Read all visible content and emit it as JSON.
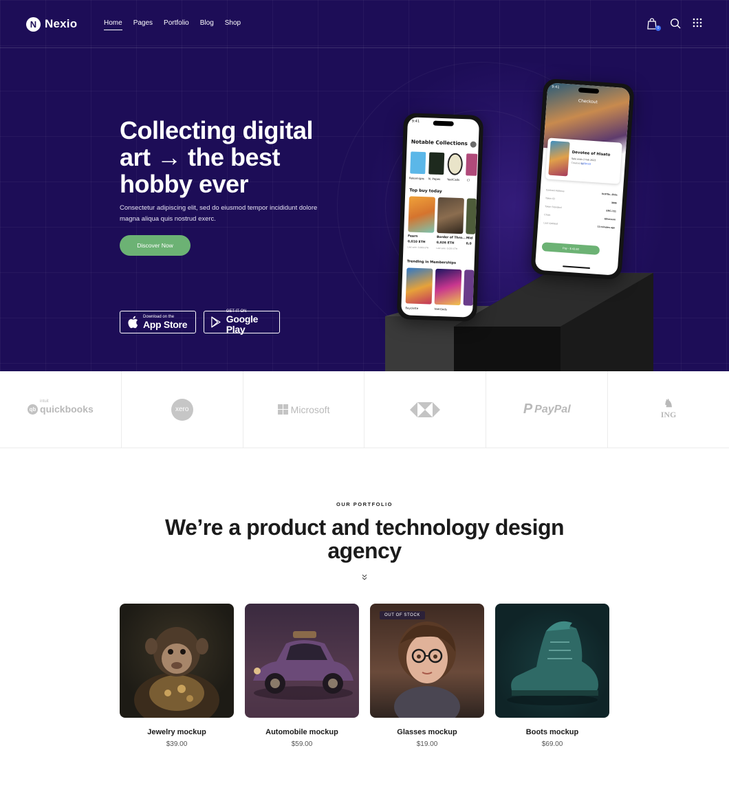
{
  "header": {
    "logo_mark": "N",
    "logo_text": "Nexio",
    "nav": [
      "Home",
      "Pages",
      "Portfolio",
      "Blog",
      "Shop"
    ],
    "active_nav": "Home",
    "cart_count": "0",
    "icons": [
      "shopping-bag-icon",
      "search-icon",
      "grid-menu-icon"
    ]
  },
  "hero": {
    "title": "Collecting digital art → the best hobby ever",
    "subtitle": "Consectetur adipiscing elit, sed do eiusmod tempor incididunt dolore magna aliqua quis nostrud exerc.",
    "cta": "Discover Now",
    "app_store": {
      "small": "Download on the",
      "big": "App Store"
    },
    "google_play": {
      "small": "GET IT ON",
      "big": "Google Play"
    }
  },
  "phone_left": {
    "time": "9:41",
    "heading": "Notable Collections",
    "collections": [
      "Rekamigas",
      "N. Pepes",
      "YeetCads",
      "Cl"
    ],
    "top_buy_label": "Top buy today",
    "top_buys": [
      {
        "name": "Fearn",
        "price": "0,010 ETH",
        "sub": "Last sale: 0,009 ETH"
      },
      {
        "name": "Border of Thro...",
        "price": "0,026 ETH",
        "sub": "Last sale: 0,025 ETH"
      },
      {
        "name": "Mid",
        "price": "0,0",
        "sub": ""
      }
    ],
    "trending_label": "Trending in Memberships",
    "trending": [
      "Bayclette",
      "YeetGods"
    ]
  },
  "phone_right": {
    "time": "9:41",
    "heading": "Checkout",
    "item_title": "Devotee of Hisato",
    "item_sub": "Sale ends 2 Feb 2023",
    "item_by": "Created by",
    "item_creator": "@ZBRED",
    "rows": [
      {
        "k": "Contract Address",
        "v": "0xd78a...2b3a"
      },
      {
        "k": "Token ID",
        "v": "3806"
      },
      {
        "k": "Token Standard",
        "v": "ERC-721"
      },
      {
        "k": "Chain",
        "v": "Ethereum"
      },
      {
        "k": "Last Updated",
        "v": "13 minutes ago"
      }
    ],
    "pay_button": "Pay - $ 43.60"
  },
  "partners": [
    "quickbooks",
    "xero",
    "Microsoft",
    "HSBC",
    "PayPal",
    "ING"
  ],
  "partners_small": {
    "quickbooks": "intuit"
  },
  "portfolio": {
    "eyebrow": "OUR PORTFOLIO",
    "title": "We’re a product and technology design agency",
    "products": [
      {
        "name": "Jewelry mockup",
        "price": "$39.00",
        "badge": ""
      },
      {
        "name": "Automobile mockup",
        "price": "$59.00",
        "badge": ""
      },
      {
        "name": "Glasses mockup",
        "price": "$19.00",
        "badge": "OUT OF STOCK"
      },
      {
        "name": "Boots mockup",
        "price": "$69.00",
        "badge": ""
      }
    ]
  },
  "colors": {
    "hero_bg": "#1d0d57",
    "accent_green": "#6cb274",
    "badge_blue": "#3d6df2"
  }
}
